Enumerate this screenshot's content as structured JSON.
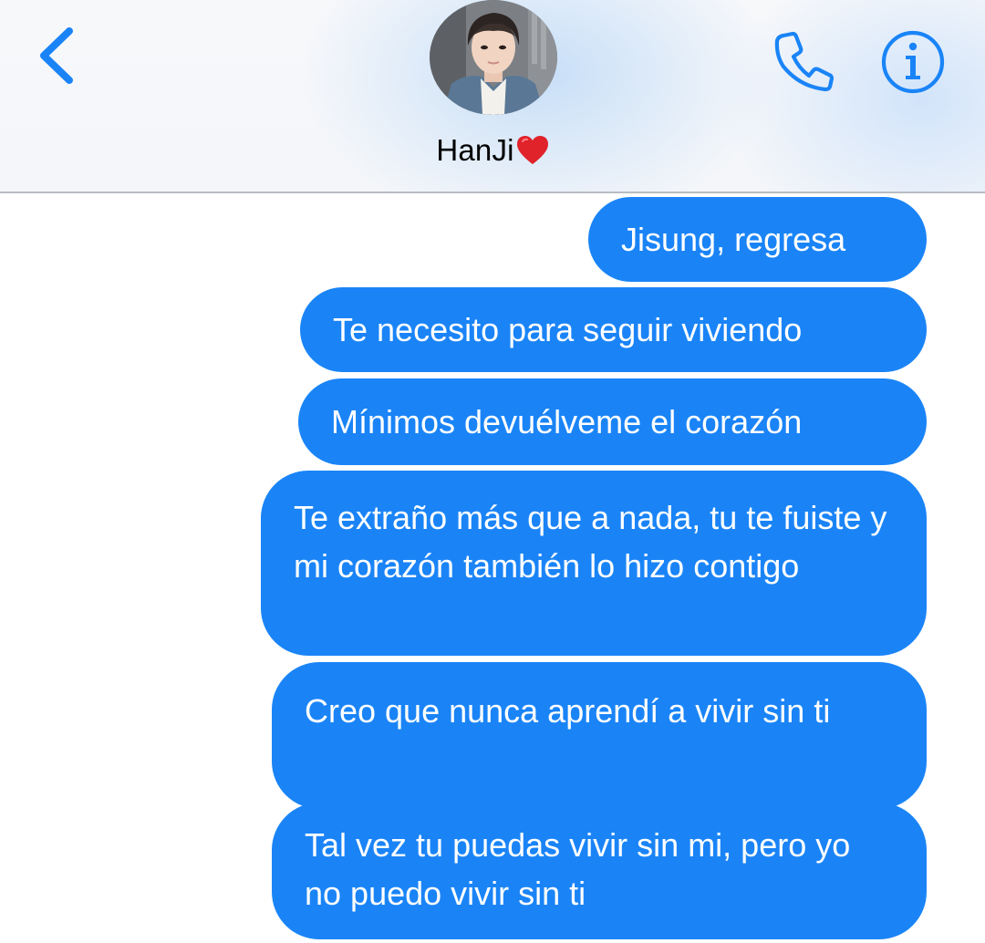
{
  "header": {
    "contact_name": "HanJi",
    "back_icon": "chevron-left-icon",
    "phone_icon": "phone-icon",
    "info_icon": "info-icon",
    "name_emoji": "red-heart-icon",
    "accent_color": "#1a84f7"
  },
  "messages": [
    {
      "text": "Jisung, regresa",
      "sender": "me"
    },
    {
      "text": "Te necesito para seguir viviendo",
      "sender": "me"
    },
    {
      "text": "Mínimos devuélveme el corazón",
      "sender": "me"
    },
    {
      "text": "Te extraño más que a nada, tu te fuiste y mi corazón también lo hizo contigo",
      "sender": "me"
    },
    {
      "text": "Creo que nunca aprendí a vivir sin ti",
      "sender": "me"
    },
    {
      "text": "Tal vez tu puedas vivir sin mi, pero yo no puedo vivir sin ti",
      "sender": "me"
    }
  ],
  "colors": {
    "bubble": "#1a84f7",
    "bubble_text": "#ffffff",
    "header_divider": "#b9bcc2"
  }
}
